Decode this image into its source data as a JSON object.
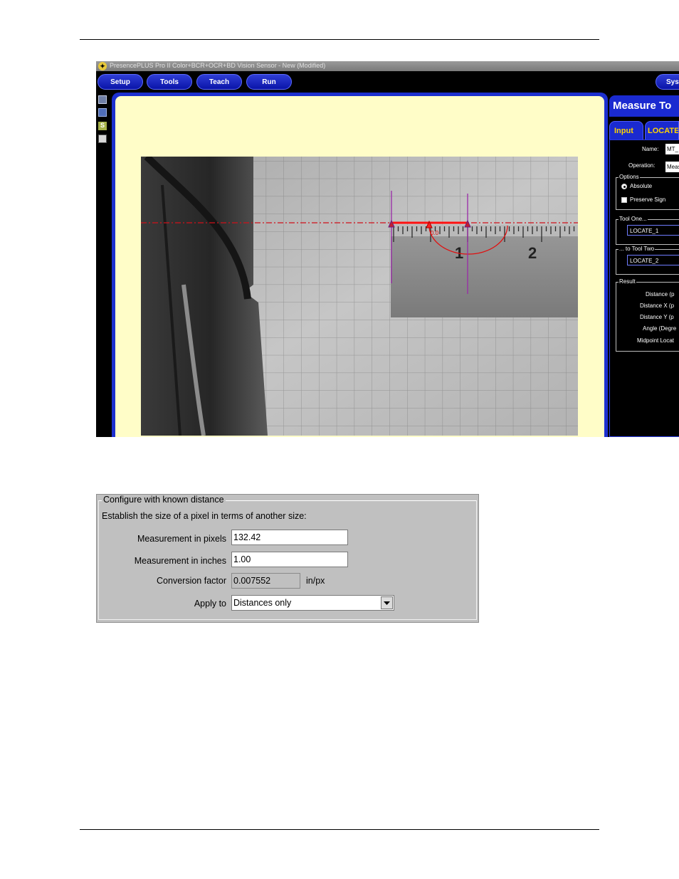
{
  "app": {
    "title": "PresencePLUS  Pro II Color+BCR+OCR+BD Vision Sensor - New (Modified)",
    "menu": [
      "Setup",
      "Tools",
      "Teach",
      "Run",
      "Sys"
    ],
    "camera_annotations": {
      "ruler_marks": [
        "1",
        "2"
      ],
      "angle_label": "0.0"
    },
    "panel": {
      "title": "Measure To",
      "tabs": [
        "Input",
        "LOCATE"
      ],
      "name_label": "Name:",
      "name_value": "MT_",
      "operation_label": "Operation:",
      "operation_value": "Meas",
      "options_label": "Options",
      "option_absolute": "Absolute",
      "option_preserve_sign": "Preserve Sign",
      "tool_one_label": "Tool One...",
      "tool_one_value": "LOCATE_1",
      "tool_two_label": "... to Tool Two",
      "tool_two_value": "LOCATE_2",
      "result_label": "Result",
      "results": [
        "Distance  (p",
        "Distance X  (p",
        "Distance Y  (p",
        "Angle (Degre",
        "Midpoint Locat"
      ]
    }
  },
  "dialog": {
    "group_title": "Configure with known distance",
    "instruction": "Establish the size of a pixel in terms of another size:",
    "pixels_label": "Measurement in pixels",
    "pixels_value": "132.42",
    "inches_label": "Measurement in inches",
    "inches_value": "1.00",
    "conversion_label": "Conversion factor",
    "conversion_value": "0.007552",
    "conversion_unit": "in/px",
    "apply_label": "Apply to",
    "apply_value": "Distances only"
  },
  "colors": {
    "menu_blue": "#1a2ad0",
    "work_area": "#fffdc8",
    "tab_text": "#ffd400",
    "dialog_bg": "#c0c0c0"
  }
}
